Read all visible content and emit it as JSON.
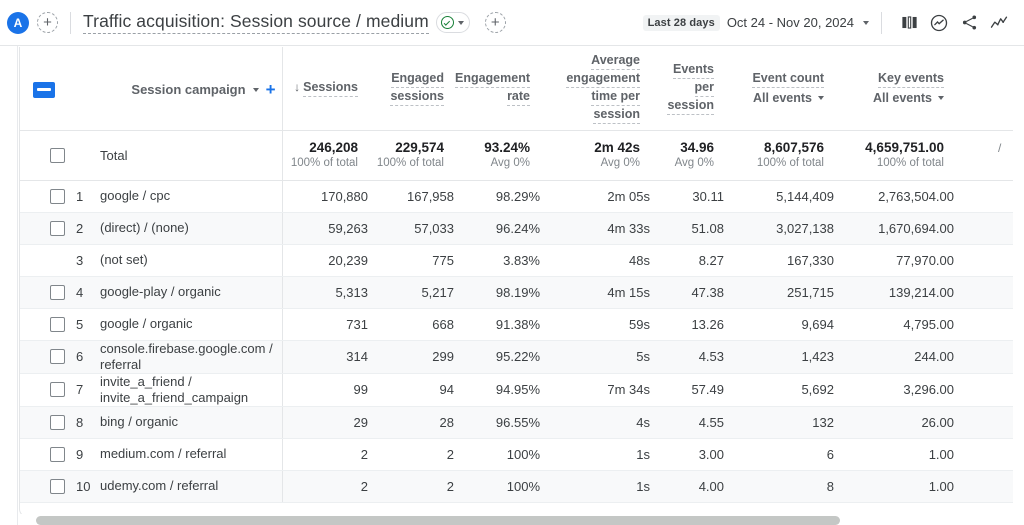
{
  "topbar": {
    "avatar_initial": "A",
    "add_label": "+",
    "title": "Traffic acquisition: Session source / medium",
    "date_chip": "Last 28 days",
    "date_range": "Oct 24 - Nov 20, 2024",
    "icons": [
      "compare-icon",
      "insights-icon",
      "share-icon",
      "trend-icon"
    ]
  },
  "table": {
    "dimension_header": {
      "label": "Session campaign",
      "add_label": "+"
    },
    "columns": [
      {
        "label": "Sessions",
        "sorted": true
      },
      {
        "label_line1": "Engaged",
        "label_line2": "sessions"
      },
      {
        "label_line1": "Engagement",
        "label_line2": "rate"
      },
      {
        "label_line1": "Average",
        "label_line2": "engagement",
        "label_line3": "time per",
        "label_line4": "session"
      },
      {
        "label_line1": "Events",
        "label_line2": "per",
        "label_line3": "session"
      },
      {
        "label": "Event count",
        "sub": "All events"
      },
      {
        "label": "Key events",
        "sub": "All events"
      }
    ],
    "total": {
      "label": "Total",
      "sessions": "246,208",
      "sessions_sub": "100% of total",
      "engaged": "229,574",
      "engaged_sub": "100% of total",
      "rate": "93.24%",
      "rate_sub": "Avg 0%",
      "time": "2m 42s",
      "time_sub": "Avg 0%",
      "eps": "34.96",
      "eps_sub": "Avg 0%",
      "event_count": "8,607,576",
      "event_count_sub": "100% of total",
      "key_events": "4,659,751.00",
      "key_events_sub": "100% of total"
    },
    "rows": [
      {
        "rank": "1",
        "dimension": "google / cpc",
        "sessions": "170,880",
        "engaged": "167,958",
        "rate": "98.29%",
        "time": "2m 05s",
        "eps": "30.11",
        "event_count": "5,144,409",
        "key_events": "2,763,504.00",
        "checkbox": true,
        "highlighted": false
      },
      {
        "rank": "2",
        "dimension": "(direct) / (none)",
        "sessions": "59,263",
        "engaged": "57,033",
        "rate": "96.24%",
        "time": "4m 33s",
        "eps": "51.08",
        "event_count": "3,027,138",
        "key_events": "1,670,694.00",
        "checkbox": true,
        "highlighted": false
      },
      {
        "rank": "3",
        "dimension": "(not set)",
        "sessions": "20,239",
        "engaged": "775",
        "rate": "3.83%",
        "time": "48s",
        "eps": "8.27",
        "event_count": "167,330",
        "key_events": "77,970.00",
        "checkbox": false,
        "highlighted": false
      },
      {
        "rank": "4",
        "dimension": "google-play / organic",
        "sessions": "5,313",
        "engaged": "5,217",
        "rate": "98.19%",
        "time": "4m 15s",
        "eps": "47.38",
        "event_count": "251,715",
        "key_events": "139,214.00",
        "checkbox": true,
        "highlighted": true
      },
      {
        "rank": "5",
        "dimension": "google / organic",
        "sessions": "731",
        "engaged": "668",
        "rate": "91.38%",
        "time": "59s",
        "eps": "13.26",
        "event_count": "9,694",
        "key_events": "4,795.00",
        "checkbox": true,
        "highlighted": false
      },
      {
        "rank": "6",
        "dimension": "console.firebase.google.com / referral",
        "sessions": "314",
        "engaged": "299",
        "rate": "95.22%",
        "time": "5s",
        "eps": "4.53",
        "event_count": "1,423",
        "key_events": "244.00",
        "checkbox": true,
        "highlighted": false
      },
      {
        "rank": "7",
        "dimension": "invite_a_friend / invite_a_friend_campaign",
        "sessions": "99",
        "engaged": "94",
        "rate": "94.95%",
        "time": "7m 34s",
        "eps": "57.49",
        "event_count": "5,692",
        "key_events": "3,296.00",
        "checkbox": true,
        "highlighted": false
      },
      {
        "rank": "8",
        "dimension": "bing / organic",
        "sessions": "29",
        "engaged": "28",
        "rate": "96.55%",
        "time": "4s",
        "eps": "4.55",
        "event_count": "132",
        "key_events": "26.00",
        "checkbox": true,
        "highlighted": false
      },
      {
        "rank": "9",
        "dimension": "medium.com / referral",
        "sessions": "2",
        "engaged": "2",
        "rate": "100%",
        "time": "1s",
        "eps": "3.00",
        "event_count": "6",
        "key_events": "1.00",
        "checkbox": true,
        "highlighted": false
      },
      {
        "rank": "10",
        "dimension": "udemy.com / referral",
        "sessions": "2",
        "engaged": "2",
        "rate": "100%",
        "time": "1s",
        "eps": "4.00",
        "event_count": "8",
        "key_events": "1.00",
        "checkbox": true,
        "highlighted": false
      }
    ]
  },
  "colors": {
    "accent": "#1a73e8",
    "success": "#188038",
    "text": "#3c4043",
    "muted": "#80868b",
    "highlight": "#d6d6d6",
    "alt_row": "#f8f9fa"
  }
}
